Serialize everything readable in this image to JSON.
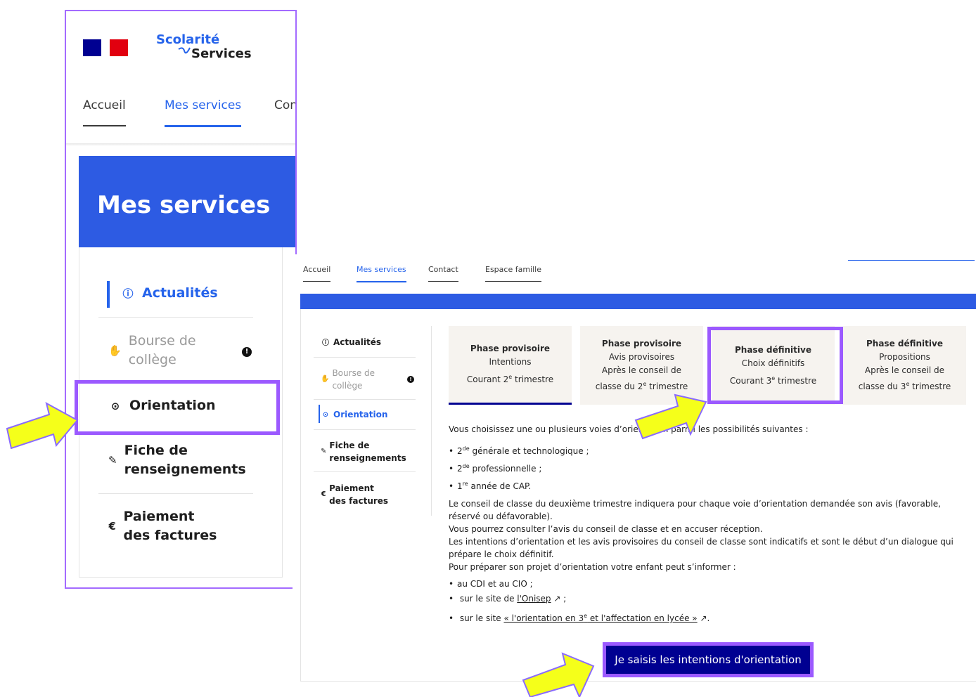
{
  "left": {
    "logo": {
      "line1": "Scolarité",
      "line2": "Services"
    },
    "nav": [
      "Accueil",
      "Mes services",
      "Con"
    ],
    "banner_title": "Mes services",
    "menu": {
      "actualites": "Actualités",
      "bourse": "Bourse de collège",
      "bourse_badge": "!",
      "orientation": "Orientation",
      "fiche": "Fiche de renseignements",
      "paiement": "Paiement des factures"
    }
  },
  "right": {
    "nav": [
      "Accueil",
      "Mes services",
      "Contact",
      "Espace famille"
    ],
    "menu": {
      "actualites": "Actualités",
      "bourse": "Bourse de collège",
      "bourse_badge": "!",
      "orientation": "Orientation",
      "fiche": "Fiche de renseignements",
      "paiement": "Paiement des factures"
    },
    "phases": [
      {
        "title": "Phase provisoire",
        "lines": [
          "Intentions"
        ],
        "period": "Courant 2",
        "period_sup": "e",
        "period_end": " trimestre"
      },
      {
        "title": "Phase provisoire",
        "lines": [
          "Avis provisoires",
          "Après le conseil de"
        ],
        "period": "classe du 2",
        "period_sup": "e",
        "period_end": " trimestre"
      },
      {
        "title": "Phase définitive",
        "lines": [
          "Choix définitifs"
        ],
        "period": "Courant 3",
        "period_sup": "e",
        "period_end": " trimestre"
      },
      {
        "title": "Phase définitive",
        "lines": [
          "Propositions",
          "Après le conseil de"
        ],
        "period": "classe du 3",
        "period_sup": "e",
        "period_end": " trimestre"
      }
    ],
    "intro": "Vous choisissez une ou plusieurs voies d’orientation parmi les possibilités suivantes :",
    "options": [
      {
        "pre": "2",
        "sup": "de",
        "post": " générale et technologique ;"
      },
      {
        "pre": "2",
        "sup": "de",
        "post": " professionnelle ;"
      },
      {
        "pre": "1",
        "sup": "re",
        "post": " année de CAP."
      }
    ],
    "paragraph1": "Le conseil de classe du deuxième trimestre indiquera pour chaque voie d’orientation demandée son avis (favorable, réservé ou défavorable).",
    "paragraph2": "Vous pourrez consulter l’avis du conseil de classe et en accuser réception.",
    "paragraph3": "Les intentions d’orientation et les avis provisoires du conseil de classe sont indicatifs et sont le début d’un dialogue qui prépare le choix définitif.",
    "paragraph4": "Pour préparer son projet d’orientation votre enfant peut s’informer :",
    "info": {
      "cdi": "au CDI et au CIO ;",
      "onisep_pre": "sur le site de ",
      "onisep_link": "l'Onisep",
      "onisep_post": " ;",
      "site_pre": "sur le site ",
      "site_link_a": "« l'orientation en 3",
      "site_link_sup": "e",
      "site_link_b": " et l'affectation en lycée »",
      "site_post": "."
    },
    "cta": "Je saisis les intentions d'orientation"
  },
  "colors": {
    "blue": "#2d5be3",
    "navy": "#000091",
    "highlight": "#9b59ff",
    "arrow": "#f5ff1a",
    "phase_bg": "#f6f3ef"
  }
}
